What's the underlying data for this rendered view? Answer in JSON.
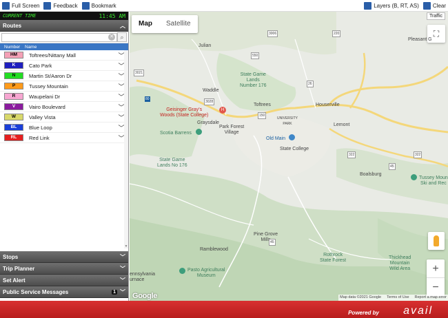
{
  "toolbar": {
    "full_screen": "Full Screen",
    "feedback": "Feedback",
    "bookmark": "Bookmark",
    "layers": "Layers (B, RT, AS)",
    "clear": "Clear"
  },
  "clock": {
    "label": "CURRENT TIME",
    "time": "11:45 AM"
  },
  "routes_panel": {
    "title": "Routes",
    "search_placeholder": "",
    "col_number": "Number",
    "col_name": "Name",
    "routes": [
      {
        "code": "HM",
        "name": "Toftrees/Nittany Mall",
        "color": "#f4a0b6",
        "text": "#000000"
      },
      {
        "code": "K",
        "name": "Cato Park",
        "color": "#1f1fbf",
        "text": "#ffffff"
      },
      {
        "code": "N",
        "name": "Martin St/Aaron Dr",
        "color": "#22dd22",
        "text": "#000000"
      },
      {
        "code": "P",
        "name": "Tussey Mountain",
        "color": "#ff9a1a",
        "text": "#000000"
      },
      {
        "code": "R",
        "name": "Waupelani Dr",
        "color": "#f7a6d1",
        "text": "#000000"
      },
      {
        "code": "V",
        "name": "Vairo Boulevard",
        "color": "#8b1b9e",
        "text": "#ffffff"
      },
      {
        "code": "W",
        "name": "Valley Vista",
        "color": "#d8d86a",
        "text": "#000000"
      },
      {
        "code": "BL",
        "name": "Blue Loop",
        "color": "#1a3fd9",
        "text": "#ffffff"
      },
      {
        "code": "RL",
        "name": "Red Link",
        "color": "#e51f1f",
        "text": "#ffffff"
      }
    ]
  },
  "sections": {
    "stops": "Stops",
    "trip_planner": "Trip Planner",
    "set_alert": "Set Alert",
    "psm": "Public Service Messages",
    "psm_count": "1"
  },
  "map": {
    "tab_map": "Map",
    "tab_satellite": "Satellite",
    "traffic": "Traffic",
    "labels": {
      "julian": "Julian",
      "pleasant": "Pleasant G",
      "sgl176": "State Game\nLands\nNumber 176",
      "waddle": "Waddle",
      "toftrees": "Toftrees",
      "houserville": "Houserville",
      "geisinger": "Geisinger Gray's\nWoods (State College)",
      "graysdale": "Graysdale",
      "univpark": "UNIVERSITY\nPARK",
      "parkforest": "Park Forest\nVillage",
      "scotia": "Scotia Barrens",
      "oldmain": "Old Main",
      "lemont": "Lemont",
      "statecollege": "State College",
      "sgl176b": "State Game\nLands No 176",
      "boalsburg": "Boalsburg",
      "tussey": "Tussey Moun\nSki and Rec",
      "pinegrove": "Pine Grove\nMills",
      "ramblewood": "Ramblewood",
      "rothrock": "Rothrock\nState Forest",
      "thickhead": "Thickhead\nMountain\nWild Area",
      "pasto": "Pasto Agricultural\nMuseum",
      "pennsylvania": "ennsylvania\nurnace"
    },
    "route_numbers": {
      "r3006": "3006",
      "r550": "550",
      "r220": "220",
      "r26": "26",
      "r80": "80",
      "r3021": "3021",
      "r3028": "3028",
      "r150": "150",
      "r45": "45",
      "r322": "322",
      "r322b": "322",
      "r45b": "45"
    },
    "attribution": {
      "data": "Map data ©2021 Google",
      "terms": "Terms of Use",
      "report": "Report a map error"
    },
    "google": "Google"
  },
  "footer": {
    "powered_by": "Powered by",
    "brand": "avail"
  }
}
